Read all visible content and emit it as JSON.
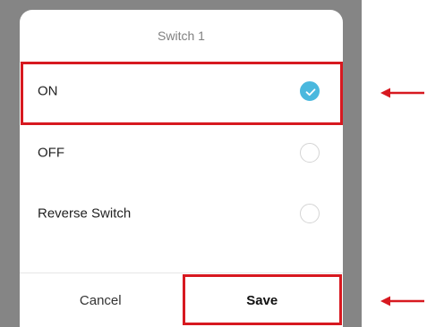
{
  "dialog": {
    "title": "Switch 1",
    "options": [
      {
        "label": "ON",
        "selected": true
      },
      {
        "label": "OFF",
        "selected": false
      },
      {
        "label": "Reverse Switch",
        "selected": false
      }
    ],
    "cancel_label": "Cancel",
    "save_label": "Save"
  },
  "colors": {
    "accent": "#4ab8de",
    "highlight": "#d71920",
    "backdrop": "#858585"
  },
  "icons": {
    "selected_option": "checkmark-icon",
    "annotation": "left-arrow-icon"
  }
}
